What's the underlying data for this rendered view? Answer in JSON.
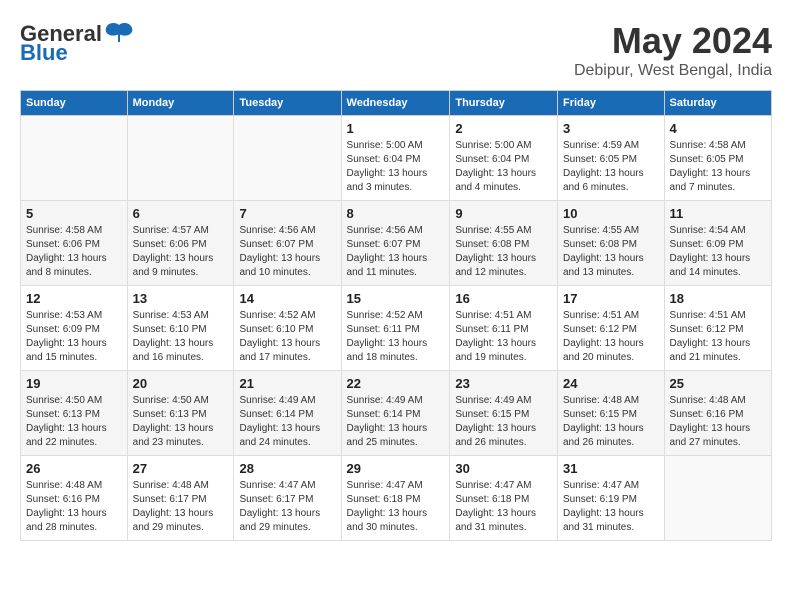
{
  "logo": {
    "general": "General",
    "blue": "Blue"
  },
  "title": {
    "month_year": "May 2024",
    "location": "Debipur, West Bengal, India"
  },
  "days_of_week": [
    "Sunday",
    "Monday",
    "Tuesday",
    "Wednesday",
    "Thursday",
    "Friday",
    "Saturday"
  ],
  "weeks": [
    [
      {
        "day": "",
        "info": ""
      },
      {
        "day": "",
        "info": ""
      },
      {
        "day": "",
        "info": ""
      },
      {
        "day": "1",
        "info": "Sunrise: 5:00 AM\nSunset: 6:04 PM\nDaylight: 13 hours\nand 3 minutes."
      },
      {
        "day": "2",
        "info": "Sunrise: 5:00 AM\nSunset: 6:04 PM\nDaylight: 13 hours\nand 4 minutes."
      },
      {
        "day": "3",
        "info": "Sunrise: 4:59 AM\nSunset: 6:05 PM\nDaylight: 13 hours\nand 6 minutes."
      },
      {
        "day": "4",
        "info": "Sunrise: 4:58 AM\nSunset: 6:05 PM\nDaylight: 13 hours\nand 7 minutes."
      }
    ],
    [
      {
        "day": "5",
        "info": "Sunrise: 4:58 AM\nSunset: 6:06 PM\nDaylight: 13 hours\nand 8 minutes."
      },
      {
        "day": "6",
        "info": "Sunrise: 4:57 AM\nSunset: 6:06 PM\nDaylight: 13 hours\nand 9 minutes."
      },
      {
        "day": "7",
        "info": "Sunrise: 4:56 AM\nSunset: 6:07 PM\nDaylight: 13 hours\nand 10 minutes."
      },
      {
        "day": "8",
        "info": "Sunrise: 4:56 AM\nSunset: 6:07 PM\nDaylight: 13 hours\nand 11 minutes."
      },
      {
        "day": "9",
        "info": "Sunrise: 4:55 AM\nSunset: 6:08 PM\nDaylight: 13 hours\nand 12 minutes."
      },
      {
        "day": "10",
        "info": "Sunrise: 4:55 AM\nSunset: 6:08 PM\nDaylight: 13 hours\nand 13 minutes."
      },
      {
        "day": "11",
        "info": "Sunrise: 4:54 AM\nSunset: 6:09 PM\nDaylight: 13 hours\nand 14 minutes."
      }
    ],
    [
      {
        "day": "12",
        "info": "Sunrise: 4:53 AM\nSunset: 6:09 PM\nDaylight: 13 hours\nand 15 minutes."
      },
      {
        "day": "13",
        "info": "Sunrise: 4:53 AM\nSunset: 6:10 PM\nDaylight: 13 hours\nand 16 minutes."
      },
      {
        "day": "14",
        "info": "Sunrise: 4:52 AM\nSunset: 6:10 PM\nDaylight: 13 hours\nand 17 minutes."
      },
      {
        "day": "15",
        "info": "Sunrise: 4:52 AM\nSunset: 6:11 PM\nDaylight: 13 hours\nand 18 minutes."
      },
      {
        "day": "16",
        "info": "Sunrise: 4:51 AM\nSunset: 6:11 PM\nDaylight: 13 hours\nand 19 minutes."
      },
      {
        "day": "17",
        "info": "Sunrise: 4:51 AM\nSunset: 6:12 PM\nDaylight: 13 hours\nand 20 minutes."
      },
      {
        "day": "18",
        "info": "Sunrise: 4:51 AM\nSunset: 6:12 PM\nDaylight: 13 hours\nand 21 minutes."
      }
    ],
    [
      {
        "day": "19",
        "info": "Sunrise: 4:50 AM\nSunset: 6:13 PM\nDaylight: 13 hours\nand 22 minutes."
      },
      {
        "day": "20",
        "info": "Sunrise: 4:50 AM\nSunset: 6:13 PM\nDaylight: 13 hours\nand 23 minutes."
      },
      {
        "day": "21",
        "info": "Sunrise: 4:49 AM\nSunset: 6:14 PM\nDaylight: 13 hours\nand 24 minutes."
      },
      {
        "day": "22",
        "info": "Sunrise: 4:49 AM\nSunset: 6:14 PM\nDaylight: 13 hours\nand 25 minutes."
      },
      {
        "day": "23",
        "info": "Sunrise: 4:49 AM\nSunset: 6:15 PM\nDaylight: 13 hours\nand 26 minutes."
      },
      {
        "day": "24",
        "info": "Sunrise: 4:48 AM\nSunset: 6:15 PM\nDaylight: 13 hours\nand 26 minutes."
      },
      {
        "day": "25",
        "info": "Sunrise: 4:48 AM\nSunset: 6:16 PM\nDaylight: 13 hours\nand 27 minutes."
      }
    ],
    [
      {
        "day": "26",
        "info": "Sunrise: 4:48 AM\nSunset: 6:16 PM\nDaylight: 13 hours\nand 28 minutes."
      },
      {
        "day": "27",
        "info": "Sunrise: 4:48 AM\nSunset: 6:17 PM\nDaylight: 13 hours\nand 29 minutes."
      },
      {
        "day": "28",
        "info": "Sunrise: 4:47 AM\nSunset: 6:17 PM\nDaylight: 13 hours\nand 29 minutes."
      },
      {
        "day": "29",
        "info": "Sunrise: 4:47 AM\nSunset: 6:18 PM\nDaylight: 13 hours\nand 30 minutes."
      },
      {
        "day": "30",
        "info": "Sunrise: 4:47 AM\nSunset: 6:18 PM\nDaylight: 13 hours\nand 31 minutes."
      },
      {
        "day": "31",
        "info": "Sunrise: 4:47 AM\nSunset: 6:19 PM\nDaylight: 13 hours\nand 31 minutes."
      },
      {
        "day": "",
        "info": ""
      }
    ]
  ]
}
